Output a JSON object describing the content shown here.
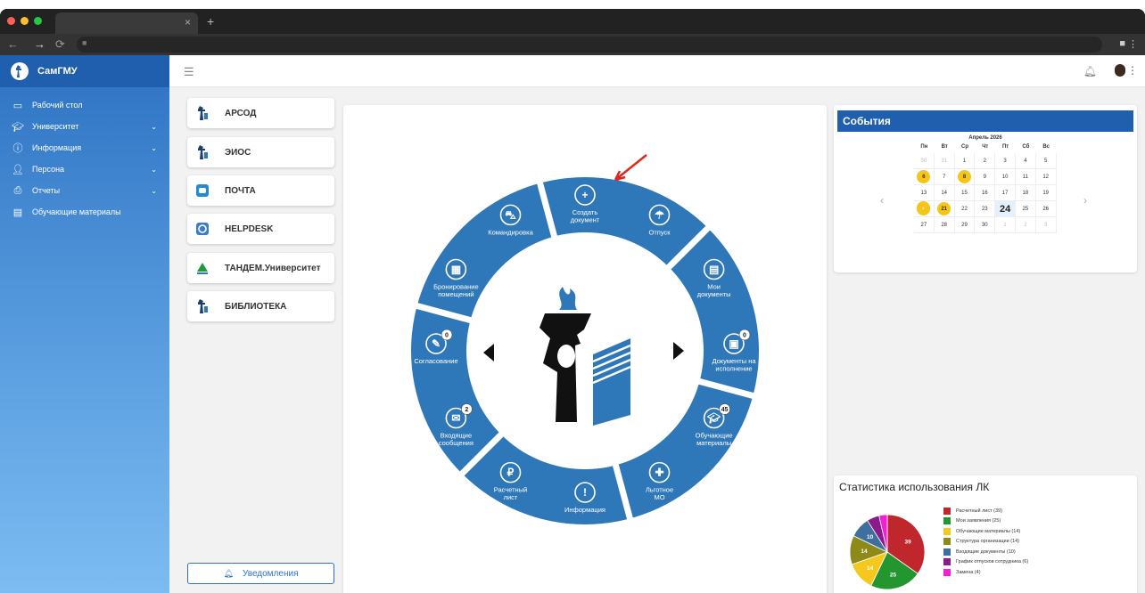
{
  "browser": {
    "dot_colors": [
      "#ff5f57",
      "#febc2e",
      "#28c840"
    ],
    "tab_close": "×",
    "new_tab": "+"
  },
  "app": {
    "name": "СамГМУ"
  },
  "sidebar": {
    "items": [
      {
        "label": "Рабочий стол",
        "icon": "desktop-icon",
        "expandable": false
      },
      {
        "label": "Университет",
        "icon": "graduation-cap-icon",
        "expandable": true
      },
      {
        "label": "Информация",
        "icon": "info-icon",
        "expandable": true
      },
      {
        "label": "Персона",
        "icon": "user-icon",
        "expandable": true
      },
      {
        "label": "Отчеты",
        "icon": "printer-icon",
        "expandable": true
      },
      {
        "label": "Обучающие материалы",
        "icon": "book-icon",
        "expandable": false
      }
    ]
  },
  "apps": [
    {
      "label": "АРСОД",
      "icon": "samgmu-logo-icon"
    },
    {
      "label": "ЭИОС",
      "icon": "samgmu-logo-icon"
    },
    {
      "label": "ПОЧТА",
      "icon": "mail-app-icon"
    },
    {
      "label": "HELPDESK",
      "icon": "helpdesk-icon"
    },
    {
      "label": "ТАНДЕМ.Университет",
      "icon": "tandem-icon"
    },
    {
      "label": "БИБЛИОТЕКА",
      "icon": "samgmu-logo-icon"
    }
  ],
  "notifications_button": "Уведомления",
  "wheel": {
    "color": "#2e77b8",
    "items": [
      {
        "lines": [
          "Создать",
          "документ"
        ],
        "icon": "plus-icon",
        "badge": null
      },
      {
        "lines": [
          "Отпуск"
        ],
        "icon": "beach-umbrella-icon",
        "badge": null
      },
      {
        "lines": [
          "Мои",
          "документы"
        ],
        "icon": "document-icon",
        "badge": null
      },
      {
        "lines": [
          "Документы на",
          "исполнение"
        ],
        "icon": "document-execute-icon",
        "badge": "0"
      },
      {
        "lines": [
          "Обучающие",
          "материалы"
        ],
        "icon": "graduation-cap-icon",
        "badge": "45"
      },
      {
        "lines": [
          "Льготное",
          "МО"
        ],
        "icon": "first-aid-icon",
        "badge": null
      },
      {
        "lines": [
          "Информация"
        ],
        "icon": "exclamation-icon",
        "badge": null
      },
      {
        "lines": [
          "Расчетный",
          "лист"
        ],
        "icon": "ruble-icon",
        "badge": null
      },
      {
        "lines": [
          "Входящие",
          "сообщения"
        ],
        "icon": "envelope-icon",
        "badge": "2"
      },
      {
        "lines": [
          "Согласование"
        ],
        "icon": "pencil-icon",
        "badge": "0"
      },
      {
        "lines": [
          "Бронирование",
          "помещений"
        ],
        "icon": "building-icon",
        "badge": null
      },
      {
        "lines": [
          "Командировка"
        ],
        "icon": "car-icon",
        "badge": null
      }
    ]
  },
  "events": {
    "title": "События",
    "calendar": {
      "month": "Апрель 2026",
      "weekdays": [
        "Пн",
        "Вт",
        "Ср",
        "Чт",
        "Пт",
        "Сб",
        "Вс"
      ],
      "weeks": [
        [
          {
            "d": "30",
            "m": true
          },
          {
            "d": "31",
            "m": true
          },
          {
            "d": "1"
          },
          {
            "d": "2"
          },
          {
            "d": "3"
          },
          {
            "d": "4"
          },
          {
            "d": "5"
          }
        ],
        [
          {
            "d": "6",
            "h": true
          },
          {
            "d": "7"
          },
          {
            "d": "8",
            "h": true
          },
          {
            "d": "9"
          },
          {
            "d": "10"
          },
          {
            "d": "11"
          },
          {
            "d": "12"
          }
        ],
        [
          {
            "d": "13"
          },
          {
            "d": "14"
          },
          {
            "d": "15"
          },
          {
            "d": "16"
          },
          {
            "d": "17"
          },
          {
            "d": "18"
          },
          {
            "d": "19"
          }
        ],
        [
          {
            "d": "20",
            "h": true,
            "b": "3"
          },
          {
            "d": "21",
            "h": true
          },
          {
            "d": "22"
          },
          {
            "d": "23"
          },
          {
            "d": "24",
            "t": true
          },
          {
            "d": "25"
          },
          {
            "d": "26"
          }
        ],
        [
          {
            "d": "27"
          },
          {
            "d": "28"
          },
          {
            "d": "29"
          },
          {
            "d": "30"
          },
          {
            "d": "1",
            "m": true
          },
          {
            "d": "2",
            "m": true
          },
          {
            "d": "3",
            "m": true
          }
        ]
      ],
      "prev": "‹",
      "next": "›"
    }
  },
  "stats": {
    "title": "Статистика использования ЛК"
  },
  "chart_data": {
    "type": "pie",
    "title": "Статистика использования ЛК",
    "series": [
      {
        "name": "Расчетный лист (39)",
        "value": 39,
        "color": "#c0272d",
        "label": "39"
      },
      {
        "name": "Мои заявления (25)",
        "value": 25,
        "color": "#24962f",
        "label": "25"
      },
      {
        "name": "Обучающие материалы (14)",
        "value": 14,
        "color": "#f4c81c",
        "label": "14"
      },
      {
        "name": "Структура организации (14)",
        "value": 14,
        "color": "#8e8a18",
        "label": "14"
      },
      {
        "name": "Входящие документы (10)",
        "value": 10,
        "color": "#3e6f9e",
        "label": "10"
      },
      {
        "name": "График отпусков сотрудника (6)",
        "value": 6,
        "color": "#8b1a8c",
        "label": ""
      },
      {
        "name": "Замена (4)",
        "value": 4,
        "color": "#f21ed8",
        "label": ""
      }
    ]
  }
}
